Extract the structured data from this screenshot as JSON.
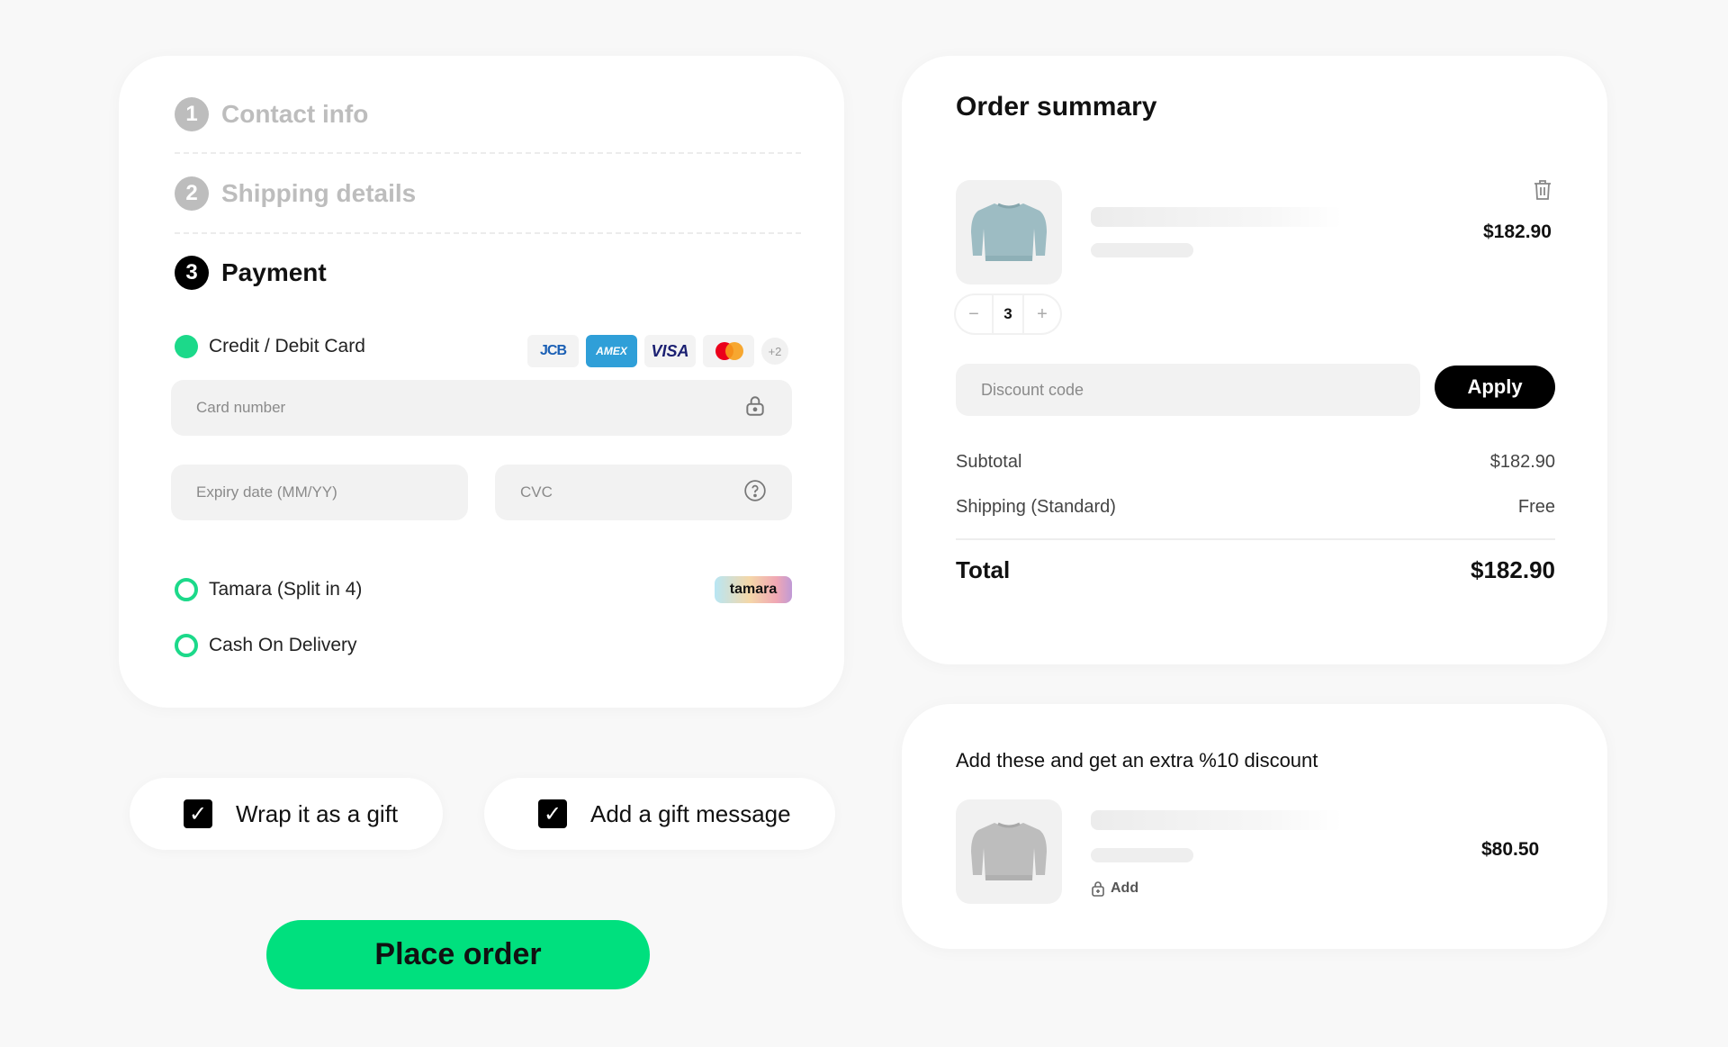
{
  "checkout": {
    "steps": [
      {
        "num": "1",
        "label": "Contact info"
      },
      {
        "num": "2",
        "label": "Shipping details"
      },
      {
        "num": "3",
        "label": "Payment"
      }
    ],
    "payment": {
      "options": [
        {
          "label": "Credit / Debit Card",
          "selected": true
        },
        {
          "label": "Tamara (Split in 4)",
          "selected": false
        },
        {
          "label": "Cash On Delivery",
          "selected": false
        }
      ],
      "brands": {
        "jcb": "JCB",
        "amex": "AMEX",
        "visa": "VISA",
        "mastercard": "mastercard",
        "more": "+2"
      },
      "tamara_logo": "tamara",
      "card_number_placeholder": "Card number",
      "expiry_placeholder": "Expiry date (MM/YY)",
      "cvc_placeholder": "CVC"
    }
  },
  "gift": {
    "wrap": {
      "label": "Wrap it as a gift",
      "checked": true
    },
    "message": {
      "label": "Add a gift message",
      "checked": true
    }
  },
  "place_order_label": "Place order",
  "summary": {
    "title": "Order summary",
    "item": {
      "price": "$182.90",
      "quantity": "3",
      "icon": "sweater-icon"
    },
    "discount_placeholder": "Discount code",
    "apply_label": "Apply",
    "subtotal_label": "Subtotal",
    "subtotal_value": "$182.90",
    "shipping_label": "Shipping (Standard)",
    "shipping_value": "Free",
    "total_label": "Total",
    "total_value": "$182.90"
  },
  "upsell": {
    "title": "Add these and get an extra %10 discount",
    "item": {
      "price": "$80.50",
      "add_label": "Add",
      "icon": "sweater-icon"
    }
  },
  "colors": {
    "accent": "#00e07e",
    "radio": "#1cd98a",
    "primary": "#000000"
  }
}
